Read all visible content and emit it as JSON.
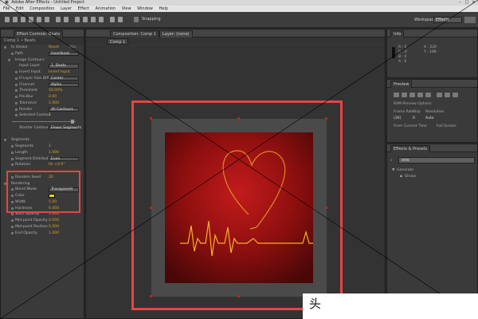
{
  "app": {
    "title": "Adobe After Effects - Untitled Project",
    "window_controls": [
      "–",
      "□",
      "×"
    ]
  },
  "menu": [
    "File",
    "Edit",
    "Composition",
    "Layer",
    "Effect",
    "Animation",
    "View",
    "Window",
    "Help"
  ],
  "toolbar": {
    "snapping_label": "Snapping",
    "workspace_label": "Workspace:",
    "workspace_value": "Effects"
  },
  "effect_controls": {
    "tab": "Effect Controls: Beats",
    "layer_path": "Comp 1 • Beats",
    "rows": [
      {
        "indent": 0,
        "tri": "▼",
        "label": "fx  Stroke",
        "reset": "Reset",
        "about": "Abo"
      },
      {
        "indent": 1,
        "stop": true,
        "label": "Path",
        "box": "Heartbeat"
      },
      {
        "indent": 1,
        "tri": "▼",
        "label": "Image Contours"
      },
      {
        "indent": 2,
        "label": "Input Layer",
        "box": "1. Beats"
      },
      {
        "indent": 2,
        "stop": true,
        "label": "Invert Input",
        "value": "Invert Input"
      },
      {
        "indent": 2,
        "stop": true,
        "label": "If Layer Size Differs",
        "box": "Center"
      },
      {
        "indent": 2,
        "stop": true,
        "label": "Channel",
        "box": "Alpha"
      },
      {
        "indent": 2,
        "stop": true,
        "label": "Threshold",
        "value": "50.00%"
      },
      {
        "indent": 2,
        "stop": true,
        "label": "Pre-Blur",
        "value": "0.00"
      },
      {
        "indent": 2,
        "stop": true,
        "label": "Tolerance",
        "value": "1.000"
      },
      {
        "indent": 2,
        "stop": true,
        "label": "Render",
        "box": "All Contours"
      },
      {
        "indent": 2,
        "stop": true,
        "label": "Selected Contour",
        "value": "1"
      },
      {
        "indent": 0,
        "slider": true
      },
      {
        "indent": 2,
        "label": "Shorter Contours Have",
        "box": "Fewer Segments"
      },
      {
        "indent": 0,
        "spacer": true
      },
      {
        "indent": 0,
        "tri": "▼",
        "label": "Segments"
      },
      {
        "indent": 1,
        "stop": true,
        "label": "Segments",
        "value": "1"
      },
      {
        "indent": 1,
        "stop": true,
        "label": "Length",
        "value": "1.000"
      },
      {
        "indent": 1,
        "stop": true,
        "label": "Segment Distribution",
        "box": "Even"
      },
      {
        "indent": 1,
        "stop": true,
        "label": "Rotation",
        "value": "0x +0.0°"
      },
      {
        "indent": 0,
        "spacer": true
      },
      {
        "indent": 1,
        "stop": true,
        "label": "Random Seed",
        "value": "26"
      },
      {
        "indent": 0,
        "tri": "▼",
        "label": "Rendering"
      },
      {
        "indent": 1,
        "stop": true,
        "label": "Blend Mode",
        "box": "Transparent"
      },
      {
        "indent": 1,
        "stop": true,
        "label": "Color",
        "swatch": "#ECD400"
      },
      {
        "indent": 1,
        "stop": true,
        "label": "Width",
        "value": "5.00"
      },
      {
        "indent": 1,
        "stop": true,
        "label": "Hardness",
        "value": "0.400"
      },
      {
        "indent": 1,
        "stop": true,
        "label": "Start Opacity",
        "value": "1.000"
      },
      {
        "indent": 1,
        "stop": true,
        "label": "Mid-point Opacity",
        "value": "0.000"
      },
      {
        "indent": 1,
        "stop": true,
        "label": "Mid-point Position",
        "value": "0.500"
      },
      {
        "indent": 1,
        "stop": true,
        "label": "End Opacity",
        "value": "1.000"
      }
    ]
  },
  "composition": {
    "tab": "Composition: Comp 1",
    "layer_tab": "Layer: (none)",
    "subtab": "Comp 1",
    "colors": {
      "highlight": "#E94344",
      "bg_center": "#C31B1B",
      "bg_edge": "#4A0707",
      "stroke": "#E8A323"
    }
  },
  "info": {
    "tab": "Info",
    "lines": [
      "R : 0",
      "G : 0",
      "B : 0",
      "A : 0",
      "X : 520",
      "Y : 188"
    ]
  },
  "preview": {
    "tab": "Preview",
    "ram_label": "RAM Preview Options",
    "frame_rate_label": "Frame Rate",
    "skip_label": "Skip",
    "resolution_label": "Resolution",
    "frame_rate_value": "(30)",
    "skip_value": "0",
    "resolution_value": "Auto",
    "from_current": "From Current Time",
    "full_screen": "Full Screen"
  },
  "effects_presets": {
    "tab": "Effects & Presets",
    "search_value": "stro",
    "categories": [
      {
        "label": "Generate",
        "items": [
          "Stroke"
        ]
      }
    ]
  },
  "watermark": "头"
}
